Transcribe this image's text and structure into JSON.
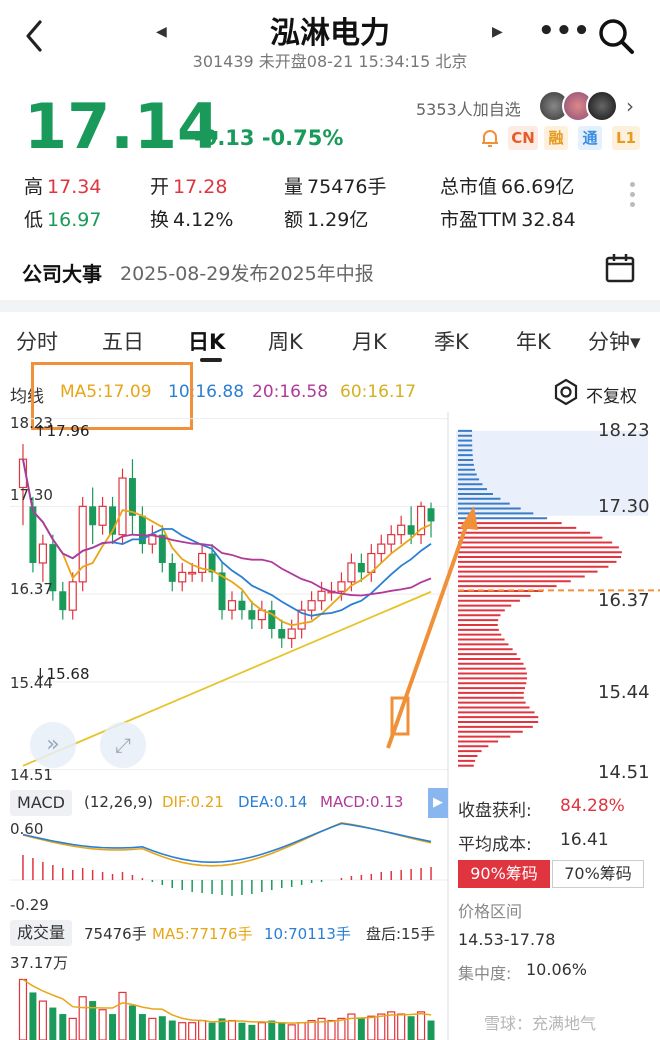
{
  "header": {
    "stock_name": "泓淋电力",
    "subtitle": "301439 未开盘08-21 15:34:15 北京",
    "more_label": "•••"
  },
  "quote": {
    "price": "17.14",
    "change": "-0.13 -0.75%",
    "watchers": "5353人加自选",
    "badges": [
      "CN",
      "融",
      "通",
      "L1"
    ]
  },
  "stats": {
    "high_label": "高",
    "high": "17.34",
    "open_label": "开",
    "open": "17.28",
    "volume_label": "量",
    "volume": "75476手",
    "mktcap_label": "总市值",
    "mktcap": "66.69亿",
    "low_label": "低",
    "low": "16.97",
    "turnover_label": "换",
    "turnover": "4.12%",
    "amount_label": "额",
    "amount": "1.29亿",
    "pe_label": "市盈TTM",
    "pe": "32.84"
  },
  "event": {
    "label": "公司大事",
    "text": "2025-08-29发布2025年中报"
  },
  "tabs": [
    "分时",
    "五日",
    "日K",
    "周K",
    "月K",
    "季K",
    "年K",
    "分钟▾"
  ],
  "active_tab": 2,
  "ma_legend": {
    "type": "均线",
    "ma5": "MA5:17.09",
    "ma10": "10:16.88",
    "ma20": "20:16.58",
    "ma60": "60:16.17",
    "adjust": "不复权"
  },
  "kline": {
    "y_labels": [
      "18.23",
      "17.30",
      "16.37",
      "15.44",
      "14.51"
    ],
    "high_mark": "17.96",
    "low_mark": "15.68",
    "right_labels": [
      "18.23",
      "17.30",
      "16.37",
      "15.44",
      "14.51"
    ]
  },
  "macd": {
    "label": "MACD",
    "params": "(12,26,9)",
    "dif": "DIF:0.21",
    "dea": "DEA:0.14",
    "macd": "MACD:0.13",
    "y_top": "0.60",
    "y_bottom": "-0.29"
  },
  "volume": {
    "label": "成交量",
    "value": "75476手",
    "ma5": "MA5:77176手",
    "ma10": "10:70113手",
    "after": "盘后:15手",
    "y_top": "37.17万"
  },
  "chips": {
    "profit_label": "收盘获利:",
    "profit": "84.28%",
    "avg_label": "平均成本:",
    "avg": "16.41",
    "tab90": "90%筹码",
    "tab70": "70%筹码",
    "range_label": "价格区间",
    "range": "14.53-17.78",
    "conc_label": "集中度:",
    "conc": "10.06%"
  },
  "watermark": "雪球：充满地气",
  "colors": {
    "up": "#e0343f",
    "down": "#1a9a5a",
    "ma5": "#e8a517",
    "ma10": "#2a7fd4",
    "ma20": "#b03a9a",
    "ma60": "#e6c42a",
    "annotation": "#f0913a"
  },
  "candles": [
    [
      17.5,
      17.8,
      17.1,
      17.96
    ],
    [
      17.3,
      16.7,
      16.6,
      17.4
    ],
    [
      16.7,
      16.9,
      16.5,
      17.0
    ],
    [
      16.9,
      16.4,
      16.3,
      17.0
    ],
    [
      16.4,
      16.2,
      16.1,
      16.5
    ],
    [
      16.2,
      16.5,
      16.1,
      16.6
    ],
    [
      16.5,
      17.3,
      16.4,
      17.4
    ],
    [
      17.3,
      17.1,
      16.9,
      17.5
    ],
    [
      17.1,
      17.3,
      17.0,
      17.4
    ],
    [
      17.3,
      17.0,
      16.9,
      17.4
    ],
    [
      17.0,
      17.6,
      16.9,
      17.7
    ],
    [
      17.6,
      17.2,
      17.0,
      17.8
    ],
    [
      17.2,
      16.9,
      16.8,
      17.3
    ],
    [
      16.9,
      17.0,
      16.8,
      17.1
    ],
    [
      17.0,
      16.7,
      16.6,
      17.1
    ],
    [
      16.7,
      16.5,
      16.4,
      16.8
    ],
    [
      16.5,
      16.6,
      16.4,
      16.7
    ],
    [
      16.6,
      16.6,
      16.5,
      16.7
    ],
    [
      16.6,
      16.8,
      16.5,
      16.9
    ],
    [
      16.8,
      16.6,
      16.5,
      16.9
    ],
    [
      16.6,
      16.2,
      16.1,
      16.7
    ],
    [
      16.2,
      16.3,
      16.1,
      16.4
    ],
    [
      16.3,
      16.2,
      16.1,
      16.4
    ],
    [
      16.2,
      16.1,
      16.0,
      16.3
    ],
    [
      16.1,
      16.2,
      16.0,
      16.3
    ],
    [
      16.2,
      16.0,
      15.9,
      16.3
    ],
    [
      16.0,
      15.9,
      15.8,
      16.1
    ],
    [
      15.9,
      16.0,
      15.8,
      16.1
    ],
    [
      16.0,
      16.2,
      15.9,
      16.3
    ],
    [
      16.2,
      16.3,
      16.1,
      16.4
    ],
    [
      16.3,
      16.4,
      16.2,
      16.5
    ],
    [
      16.4,
      16.4,
      16.3,
      16.5
    ],
    [
      16.4,
      16.5,
      16.3,
      16.6
    ],
    [
      16.5,
      16.7,
      16.4,
      16.8
    ],
    [
      16.7,
      16.6,
      16.5,
      16.8
    ],
    [
      16.6,
      16.8,
      16.5,
      16.9
    ],
    [
      16.8,
      16.9,
      16.7,
      17.0
    ],
    [
      16.9,
      17.0,
      16.8,
      17.1
    ],
    [
      17.0,
      17.1,
      16.9,
      17.2
    ],
    [
      17.1,
      17.0,
      16.9,
      17.3
    ],
    [
      17.0,
      17.3,
      16.9,
      17.35
    ],
    [
      17.28,
      17.14,
      16.97,
      17.34
    ]
  ],
  "macd_hist": [
    0.25,
    0.22,
    0.18,
    0.15,
    0.12,
    0.1,
    0.12,
    0.1,
    0.08,
    0.06,
    0.08,
    0.05,
    0.02,
    -0.02,
    -0.05,
    -0.08,
    -0.1,
    -0.12,
    -0.13,
    -0.14,
    -0.15,
    -0.16,
    -0.15,
    -0.14,
    -0.12,
    -0.1,
    -0.08,
    -0.07,
    -0.05,
    -0.03,
    -0.02,
    0.0,
    0.02,
    0.04,
    0.05,
    0.06,
    0.08,
    0.09,
    0.1,
    0.11,
    0.12,
    0.13
  ],
  "vol_bars": [
    28,
    22,
    18,
    15,
    12,
    10,
    20,
    18,
    14,
    12,
    22,
    16,
    12,
    10,
    11,
    9,
    8,
    8,
    9,
    8,
    10,
    9,
    8,
    7,
    8,
    9,
    8,
    7,
    8,
    9,
    10,
    9,
    10,
    12,
    10,
    11,
    12,
    13,
    12,
    11,
    13,
    9
  ]
}
